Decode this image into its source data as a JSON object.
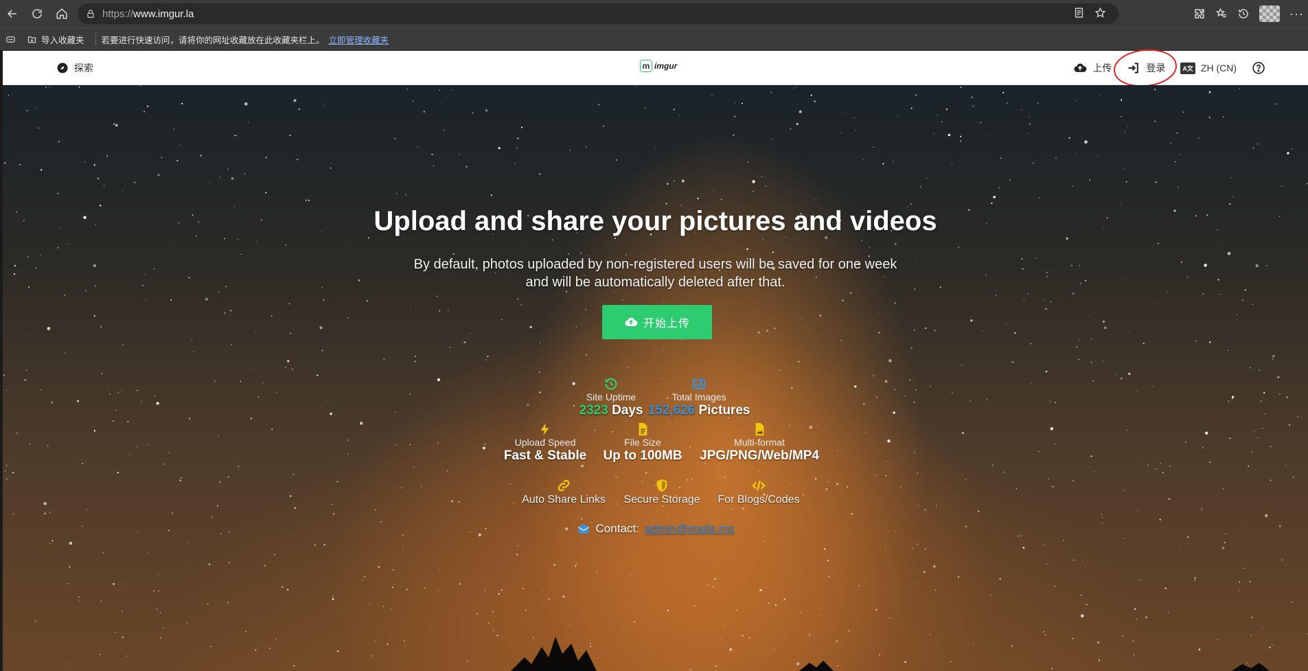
{
  "browser": {
    "url_protocol": "https://",
    "url_host": "www.imgur.la",
    "bookmarks": {
      "import_label": "导入收藏夹",
      "hint_text": "若要进行快速访问，请将你的网址收藏放在此收藏夹栏上。",
      "manage_link": "立即管理收藏夹"
    }
  },
  "header": {
    "explore_label": "探索",
    "logo_text": "imgur",
    "upload_label": "上传",
    "login_label": "登录",
    "lang_badge": "A文",
    "lang_label": "ZH (CN)"
  },
  "hero": {
    "title": "Upload and share your pictures and videos",
    "subtitle_line1": "By default, photos uploaded by non-registered users will be saved for one week",
    "subtitle_line2": "and will be automatically deleted after that.",
    "upload_button": "开始上传"
  },
  "stats": {
    "uptime": {
      "label": "Site Uptime",
      "number": "2323",
      "unit": "Days"
    },
    "images": {
      "label": "Total Images",
      "number": "152,626",
      "unit": "Pictures"
    },
    "speed": {
      "label": "Upload Speed",
      "value": "Fast & Stable"
    },
    "size": {
      "label": "File Size",
      "value": "Up to 100MB"
    },
    "format": {
      "label": "Multi-format",
      "value": "JPG/PNG/Web/MP4"
    }
  },
  "features": {
    "share": "Auto Share Links",
    "storage": "Secure Storage",
    "blogs": "For Blogs/Codes"
  },
  "contact": {
    "label": "Contact:",
    "email": "admin@mails.ms"
  },
  "colors": {
    "accent_green": "#2ecc71",
    "accent_blue": "#3d8fd8",
    "icon_yellow": "#f1c40f",
    "annotation_red": "#e22222"
  }
}
